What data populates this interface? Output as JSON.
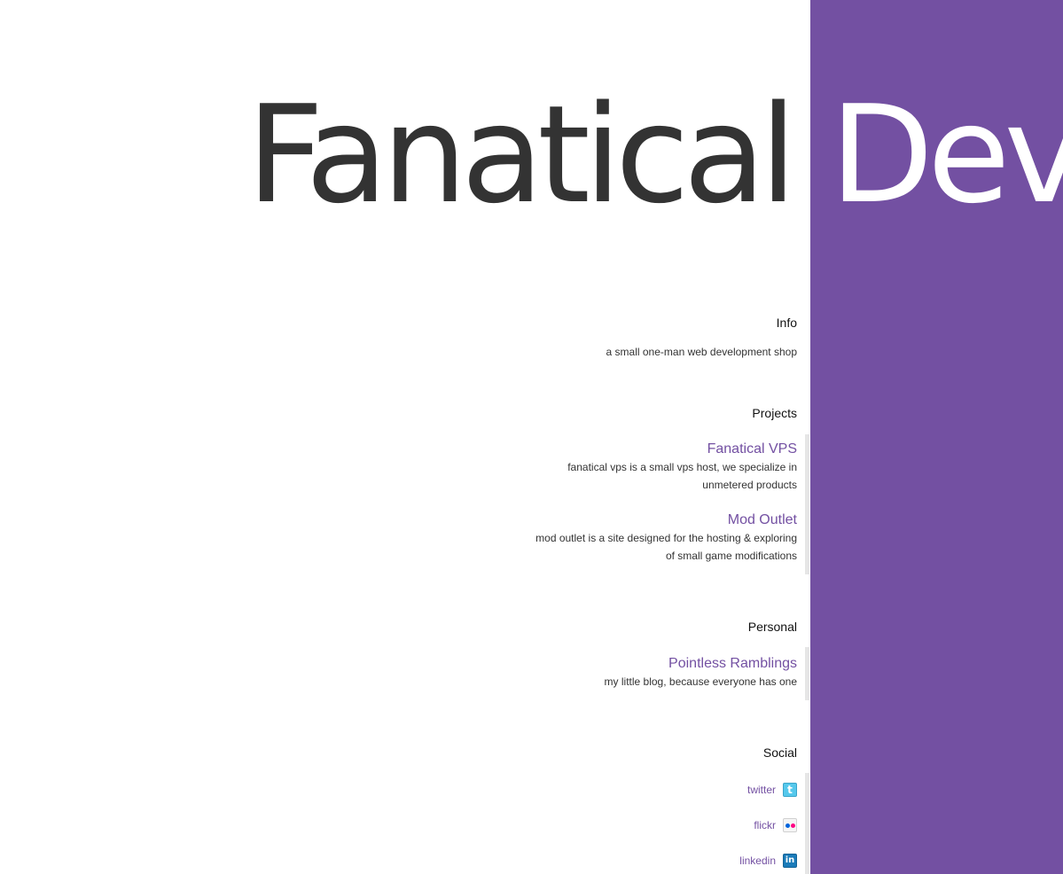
{
  "brand": {
    "word_left": "Fanatical",
    "word_right": "Dev",
    "accent_color": "#7350a2",
    "dark_color": "#333333"
  },
  "info": {
    "heading": "Info",
    "text": "a small one-man web development shop"
  },
  "projects": {
    "heading": "Projects",
    "items": [
      {
        "title": "Fanatical VPS",
        "description": "fanatical vps is a small vps host, we specialize in unmetered products"
      },
      {
        "title": "Mod Outlet",
        "description": "mod outlet is a site designed for the hosting & exploring of small game modifications"
      }
    ]
  },
  "personal": {
    "heading": "Personal",
    "items": [
      {
        "title": "Pointless Ramblings",
        "description": "my little blog, because everyone has one"
      }
    ]
  },
  "social": {
    "heading": "Social",
    "items": [
      {
        "label": "twitter",
        "icon": "twitter-icon"
      },
      {
        "label": "flickr",
        "icon": "flickr-icon"
      },
      {
        "label": "linkedin",
        "icon": "linkedin-icon"
      }
    ]
  }
}
